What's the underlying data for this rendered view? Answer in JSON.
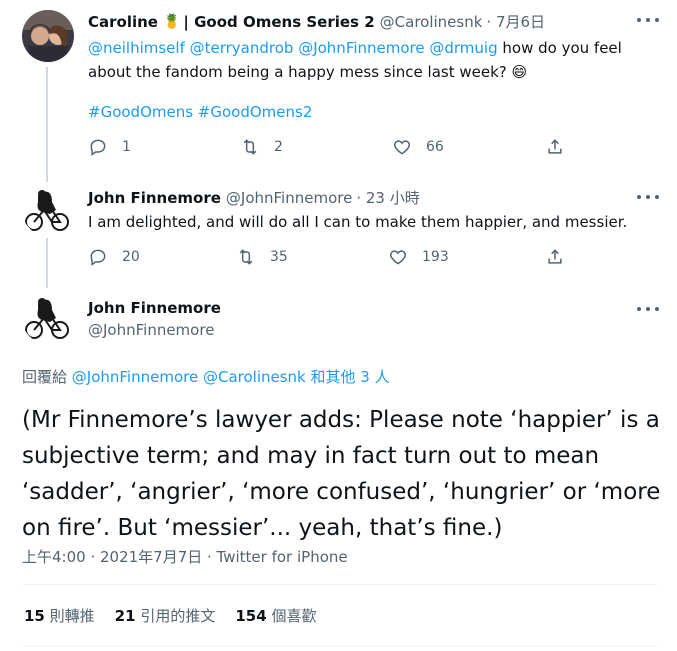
{
  "tweet1": {
    "name": "Caroline",
    "badge": "🍍",
    "name_suffix": "| Good Omens Series 2",
    "handle": "@Carolinesnk",
    "time": "· 7月6日",
    "text_mentions": "@neilhimself @terryandrob @JohnFinnemore @drmuig",
    "text_body1": " how do you feel",
    "text_line2": "about the fandom being a happy mess since last week?",
    "emoji": "😄",
    "hashtags": "#GoodOmens #GoodOmens2",
    "replies": "1",
    "retweets": "2",
    "likes": "66"
  },
  "tweet2": {
    "name": "John Finnemore",
    "handle": "@JohnFinnemore",
    "time": "· 23 小時",
    "text": "I am delighted, and will do all I can to make them happier, and messier.",
    "replies": "20",
    "retweets": "35",
    "likes": "193"
  },
  "main": {
    "name": "John Finnemore",
    "handle": "@JohnFinnemore",
    "reply_prefix": "回覆給 ",
    "reply_mentions": "@JohnFinnemore @Carolinesnk",
    "reply_suffix": " 和其他 3 人",
    "text_lines": [
      "(Mr Finnemore’s lawyer adds: Please note ‘happier’ is a",
      "subjective term; and may in fact turn out to mean",
      "‘sadder’, ‘angrier’, ‘more confused’, ‘hungrier’ or ‘more",
      "on fire’. But ‘messier’... yeah, that’s fine.)"
    ],
    "timestamp": "上午4:00 · 2021年7月7日 · Twitter for iPhone",
    "stats": [
      {
        "count": "15",
        "label": "則轉推"
      },
      {
        "count": "21",
        "label": "引用的推文"
      },
      {
        "count": "154",
        "label": "個喜歡"
      }
    ]
  },
  "colors": {
    "link": "#1d9bf0",
    "muted": "#536471",
    "line": "#cfd9de"
  },
  "icons": [
    "reply-icon",
    "retweet-icon",
    "like-icon",
    "share-icon",
    "more-icon",
    "avatar-caroline",
    "avatar-cyclist"
  ]
}
